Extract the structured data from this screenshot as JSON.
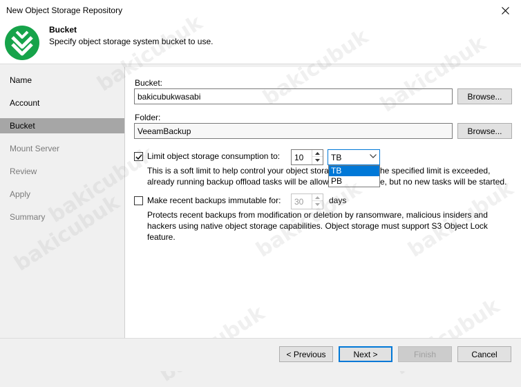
{
  "window": {
    "title": "New Object Storage Repository"
  },
  "header": {
    "title": "Bucket",
    "subtitle": "Specify object storage system bucket to use."
  },
  "sidebar": {
    "items": [
      {
        "label": "Name"
      },
      {
        "label": "Account"
      },
      {
        "label": "Bucket"
      },
      {
        "label": "Mount Server"
      },
      {
        "label": "Review"
      },
      {
        "label": "Apply"
      },
      {
        "label": "Summary"
      }
    ]
  },
  "bucket": {
    "label": "Bucket:",
    "value": "bakicubukwasabi",
    "browse_label": "Browse..."
  },
  "folder": {
    "label": "Folder:",
    "value": "VeeamBackup",
    "browse_label": "Browse..."
  },
  "limit": {
    "label": "Limit object storage consumption to:",
    "value": "10",
    "unit_selected": "TB",
    "unit_options": [
      "TB",
      "PB"
    ],
    "desc_line1_pre": "This is a soft limit to help control your object stora",
    "desc_line1_post": "he specified limit is exceeded,",
    "desc_line2_pre": "already running backup offload tasks will be allow",
    "desc_line2_post": "e, but no new tasks will be started."
  },
  "immutable": {
    "label": "Make recent backups immutable for:",
    "value": "30",
    "unit": "days",
    "desc_lines": [
      "Protects recent backups from modification or deletion by ransomware, malicious insiders and",
      "hackers using native object storage capabilities. Object storage must support S3 Object Lock",
      "feature."
    ]
  },
  "footer": {
    "previous": "< Previous",
    "next": "Next >",
    "finish": "Finish",
    "cancel": "Cancel"
  },
  "watermark": {
    "text": "bakicubuk"
  },
  "colors": {
    "accent": "#0078d7",
    "logo_green": "#16a34a",
    "selected_nav": "#a6a6a6"
  }
}
